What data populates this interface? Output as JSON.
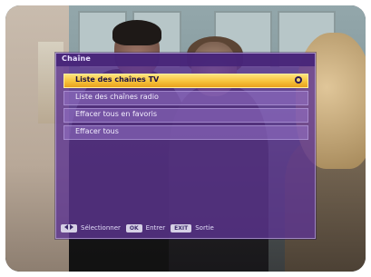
{
  "menu": {
    "title": "Chaîne",
    "items": [
      {
        "label": "Liste des chaînes TV",
        "selected": true
      },
      {
        "label": "Liste des chaînes radio",
        "selected": false
      },
      {
        "label": "Effacer tous en favoris",
        "selected": false
      },
      {
        "label": "Effacer tous",
        "selected": false
      }
    ]
  },
  "hints": [
    {
      "key": "",
      "label": "Sélectionner",
      "icon": "left-right-arrow-icon"
    },
    {
      "key": "OK",
      "label": "Entrer"
    },
    {
      "key": "EXIT",
      "label": "Sortie"
    }
  ],
  "colors": {
    "menu_bg": "#5c3491",
    "selection": "#f6c23b",
    "text": "#f3eefe"
  }
}
